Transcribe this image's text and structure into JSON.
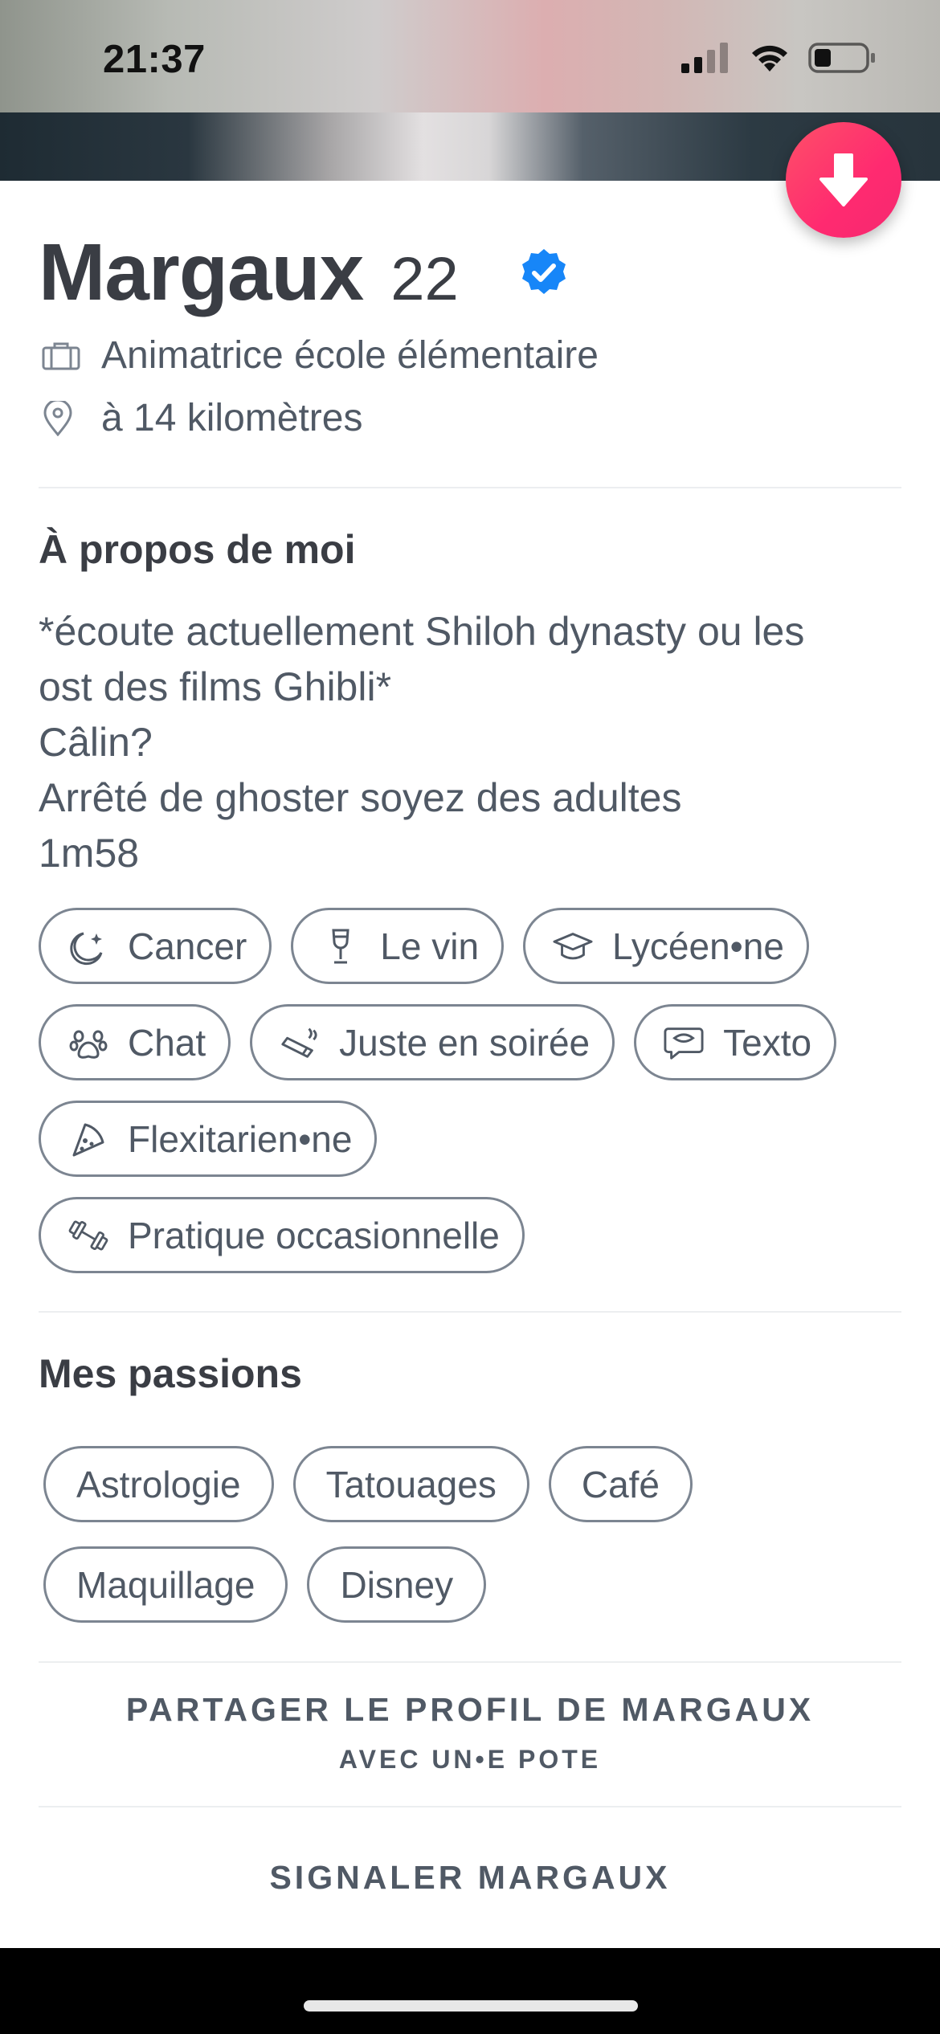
{
  "status_bar": {
    "time": "21:37"
  },
  "profile": {
    "name": "Margaux",
    "age": "22",
    "job": "Animatrice école élémentaire",
    "distance": "à 14 kilomètres"
  },
  "about": {
    "title": "À propos de moi",
    "lines": [
      "*écoute actuellement Shiloh dynasty ou les",
      "ost des films Ghibli*",
      "Câlin?",
      "Arrêté de ghoster soyez des adultes",
      "1m58"
    ],
    "chips": [
      {
        "label": "Cancer",
        "icon": "moon-stars-icon"
      },
      {
        "label": "Le vin",
        "icon": "wine-glass-icon"
      },
      {
        "label": "Lycéen•ne",
        "icon": "graduation-cap-icon"
      },
      {
        "label": "Chat",
        "icon": "paw-icon"
      },
      {
        "label": "Juste en soirée",
        "icon": "cigarette-icon"
      },
      {
        "label": "Texto",
        "icon": "chat-bubble-icon"
      },
      {
        "label": "Flexitarien•ne",
        "icon": "pizza-slice-icon"
      },
      {
        "label": "Pratique occasionnelle",
        "icon": "dumbbell-icon"
      }
    ]
  },
  "passions": {
    "title": "Mes passions",
    "items": [
      "Astrologie",
      "Tatouages",
      "Café",
      "Maquillage",
      "Disney"
    ]
  },
  "actions": {
    "share_main": "PARTAGER LE PROFIL DE MARGAUX",
    "share_sub": "AVEC UN•E POTE",
    "report": "SIGNALER MARGAUX"
  },
  "colors": {
    "accent_gradient_start": "#fd5068",
    "accent_gradient_end": "#ff2a70",
    "verified_blue": "#1786f8",
    "text": "#505965",
    "heading": "#3a3d44"
  }
}
